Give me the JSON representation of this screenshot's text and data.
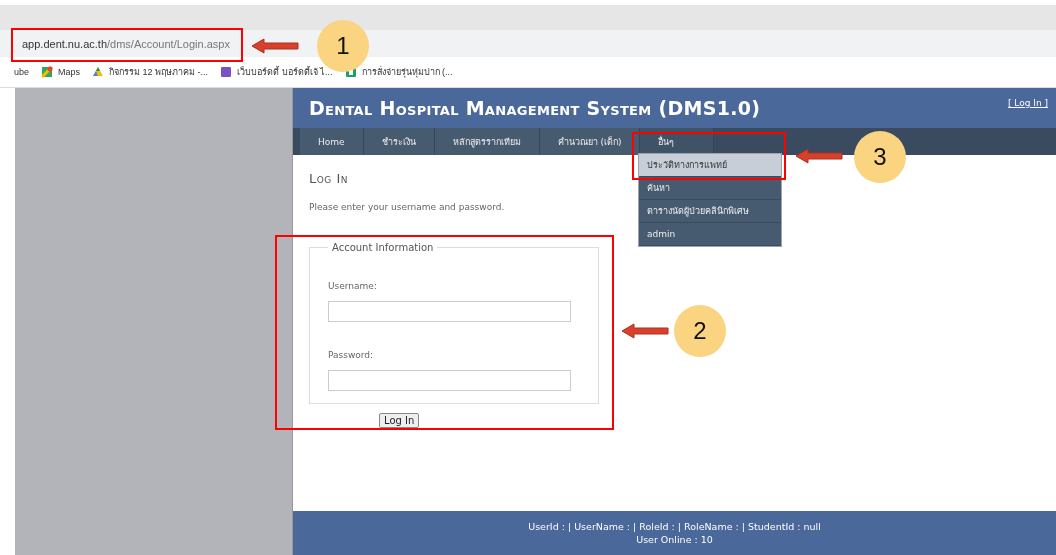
{
  "browser": {
    "url_host": "app.dent.nu.ac.th",
    "url_path": "/dms/Account/Login.aspx",
    "bookmarks": [
      {
        "kind": "text",
        "label": "ube"
      },
      {
        "kind": "maps",
        "label": "Maps"
      },
      {
        "kind": "drive",
        "label": "กิจกรรม 12 พฤษภาคม -..."
      },
      {
        "kind": "purple",
        "label": "เว็บบอร์ดดี้ บอร์ดดี้เจ้ ไ..."
      },
      {
        "kind": "green",
        "label": "การสั่งจ่ายรุ่นหุ่มปาก (..."
      }
    ]
  },
  "site": {
    "title": "Dental Hospital Management System (DMS1.0)",
    "login_link": "[ Log In ]",
    "nav": [
      {
        "label": "Home",
        "open": false
      },
      {
        "label": "ชำระเงิน",
        "open": false
      },
      {
        "label": "หลักสูตรรากเทียม",
        "open": false
      },
      {
        "label": "คำนวณยา (เด็ก)",
        "open": false
      },
      {
        "label": "อื่นๆ",
        "open": true
      }
    ],
    "menu": [
      {
        "label": "ประวัติทางการแพทย์",
        "selected": true
      },
      {
        "label": "ค้นหา",
        "selected": false
      },
      {
        "label": "ตารางนัดผู้ป่วยคลินิกพิเศษ",
        "selected": false
      },
      {
        "label": "admin",
        "selected": false
      }
    ],
    "heading": "Log In",
    "intro": "Please enter your username and password.",
    "fieldset": {
      "legend": "Account Information",
      "fields": [
        {
          "label": "Username:"
        },
        {
          "label": "Password:"
        }
      ]
    },
    "submit": "Log In",
    "footer": [
      "UserId : | UserName : | RoleId : | RoleName : | StudentId : null",
      "User Online : 10"
    ]
  },
  "annotations": [
    {
      "label": "1"
    },
    {
      "label": "2"
    },
    {
      "label": "3"
    }
  ]
}
